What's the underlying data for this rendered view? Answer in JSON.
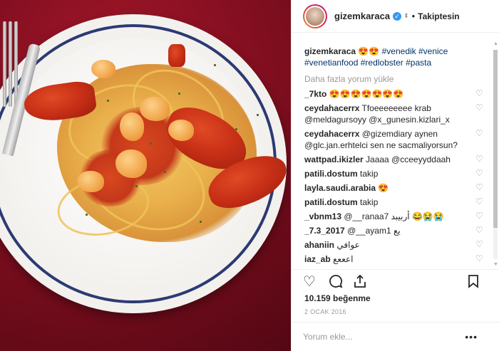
{
  "header": {
    "username": "gizemkaraca",
    "separator": "•",
    "follow_status": "Takiptesin"
  },
  "caption": {
    "username": "gizemkaraca",
    "emoji": "😍😍",
    "hashtags": "#venedik #venice #venetianfood #redlobster #pasta"
  },
  "load_more": "Daha fazla yorum yükle",
  "comments": [
    {
      "user": "_7kto",
      "text": "😍😍😍😍😍😍😍"
    },
    {
      "user": "ceydahacerrx",
      "text": "Tfoeeeeeeee krab @meldagursoyy @x_gunesin.kizlari_x"
    },
    {
      "user": "ceydahacerrx",
      "text": "@gizemdiary aynen @glc.jan.erhtelci sen ne sacmaliyorsun?"
    },
    {
      "user": "wattpad.ikizler",
      "text": "Jaaaa @cceeyyddaah"
    },
    {
      "user": "patili.dostum",
      "text": "takip"
    },
    {
      "user": "layla.saudi.arabia",
      "text": "😍"
    },
    {
      "user": "patili.dostum",
      "text": "takip"
    },
    {
      "user": "_vbnm13",
      "text": "@__ranaa7 أربيبد 😂😭😭"
    },
    {
      "user": "_7.3_2017",
      "text": "@__ayam1 يع"
    },
    {
      "user": "ahaniin",
      "text": "عوافي"
    },
    {
      "user": "iaz_ab",
      "text": "اعععع"
    }
  ],
  "icons": {
    "like": "heart-outline-icon",
    "comment": "speech-bubble-icon",
    "share": "share-icon",
    "save": "bookmark-icon",
    "verified": "verified-badge-icon",
    "more": "more-options-icon"
  },
  "likes": "10.159 beğenme",
  "date": "2 OCAK 2016",
  "comment_input": {
    "placeholder": "Yorum ekle...",
    "more": "•••"
  },
  "colors": {
    "link": "#003569",
    "verified": "#3897f0",
    "muted": "#999999"
  }
}
